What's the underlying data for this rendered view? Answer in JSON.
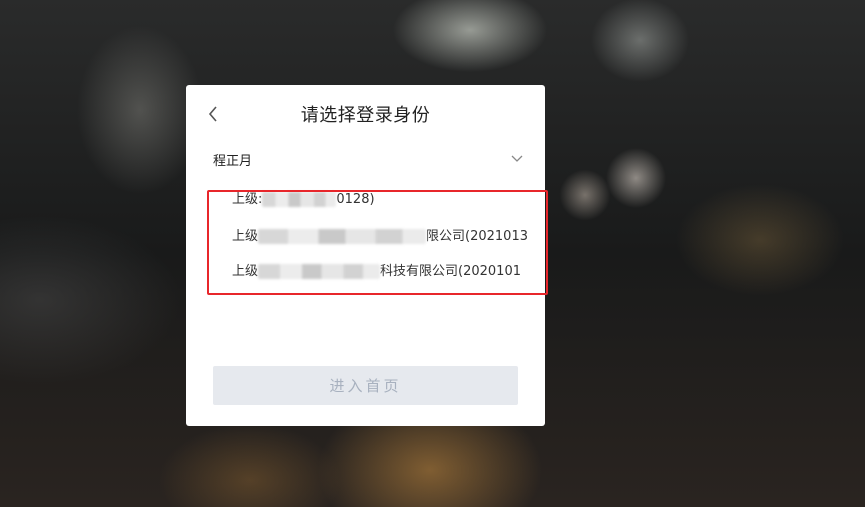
{
  "dialog": {
    "title": "请选择登录身份",
    "back_icon": "chevron-left-icon",
    "selected_identity": "程正月",
    "dropdown_icon": "chevron-down-icon",
    "options": [
      {
        "prefix": "上级:",
        "suffix": "0128)"
      },
      {
        "prefix": "上级",
        "suffix": "限公司(2021013"
      },
      {
        "prefix": "上级",
        "suffix": "科技有限公司(2020101"
      }
    ],
    "enter_button_label": "进入首页"
  },
  "colors": {
    "highlight_border": "#e8262b",
    "button_bg": "#e6e9ee",
    "button_text": "#a8b1bf"
  }
}
